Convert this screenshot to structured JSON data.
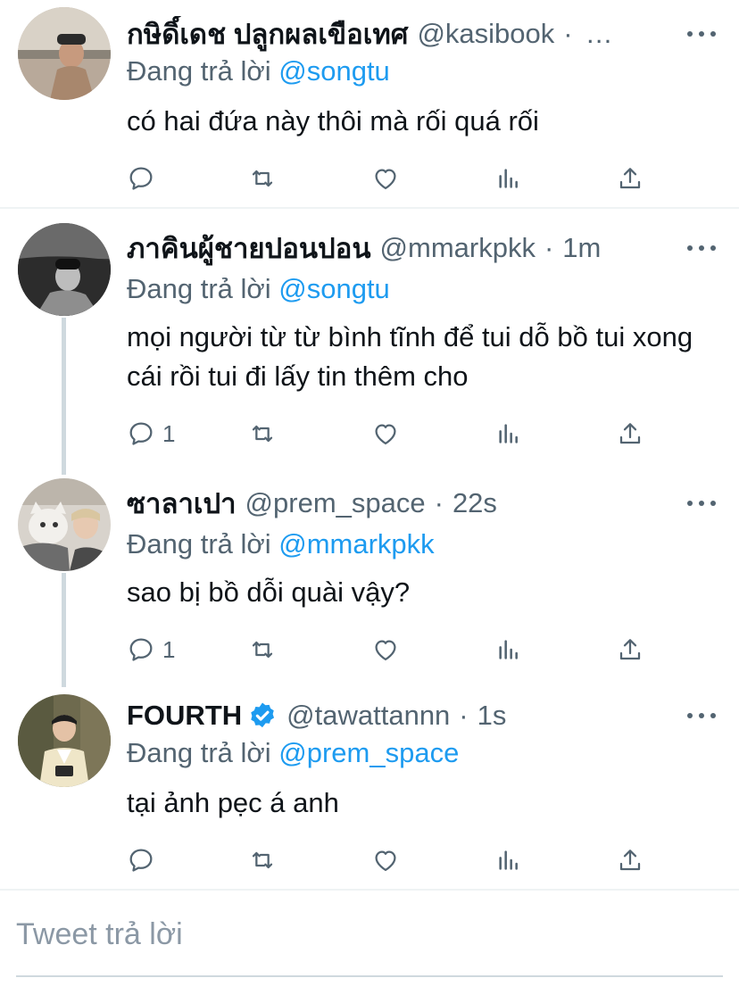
{
  "colors": {
    "accent": "#1d9bf0",
    "muted": "#536471",
    "text": "#0f1419"
  },
  "tweets": [
    {
      "name": "กษิดิ์เดช ปลูกผลเขือเทศ",
      "handle": "@kasibook",
      "time": "",
      "ellipsis": "…",
      "replying_prefix": "Đang trả lời",
      "replying_to": "@songtu",
      "text": "có hai đứa này thôi mà rối quá rối",
      "reply_count": "",
      "verified": false
    },
    {
      "name": "ภาคินผู้ชายปอนปอน",
      "handle": "@mmarkpkk",
      "time": "1m",
      "replying_prefix": "Đang trả lời",
      "replying_to": "@songtu",
      "text": "mọi người từ từ bình tĩnh để tui dỗ bồ tui xong cái rồi tui đi lấy tin thêm cho",
      "reply_count": "1",
      "verified": false
    },
    {
      "name": "ซาลาเปา",
      "handle": "@prem_space",
      "time": "22s",
      "replying_prefix": "Đang trả lời",
      "replying_to": "@mmarkpkk",
      "text": "sao bị bồ dỗi quài vậy?",
      "reply_count": "1",
      "verified": false
    },
    {
      "name": "FOURTH",
      "handle": "@tawattannn",
      "time": "1s",
      "replying_prefix": "Đang trả lời",
      "replying_to": "@prem_space",
      "text": "tại ảnh pẹc á anh",
      "reply_count": "",
      "verified": true
    }
  ],
  "icons": {
    "reply": "reply-icon",
    "retweet": "retweet-icon",
    "like": "heart-icon",
    "stats": "stats-icon",
    "share": "share-icon",
    "more": "more-icon",
    "verified": "verified-badge-icon"
  },
  "compose": {
    "placeholder": "Tweet trả lời"
  }
}
